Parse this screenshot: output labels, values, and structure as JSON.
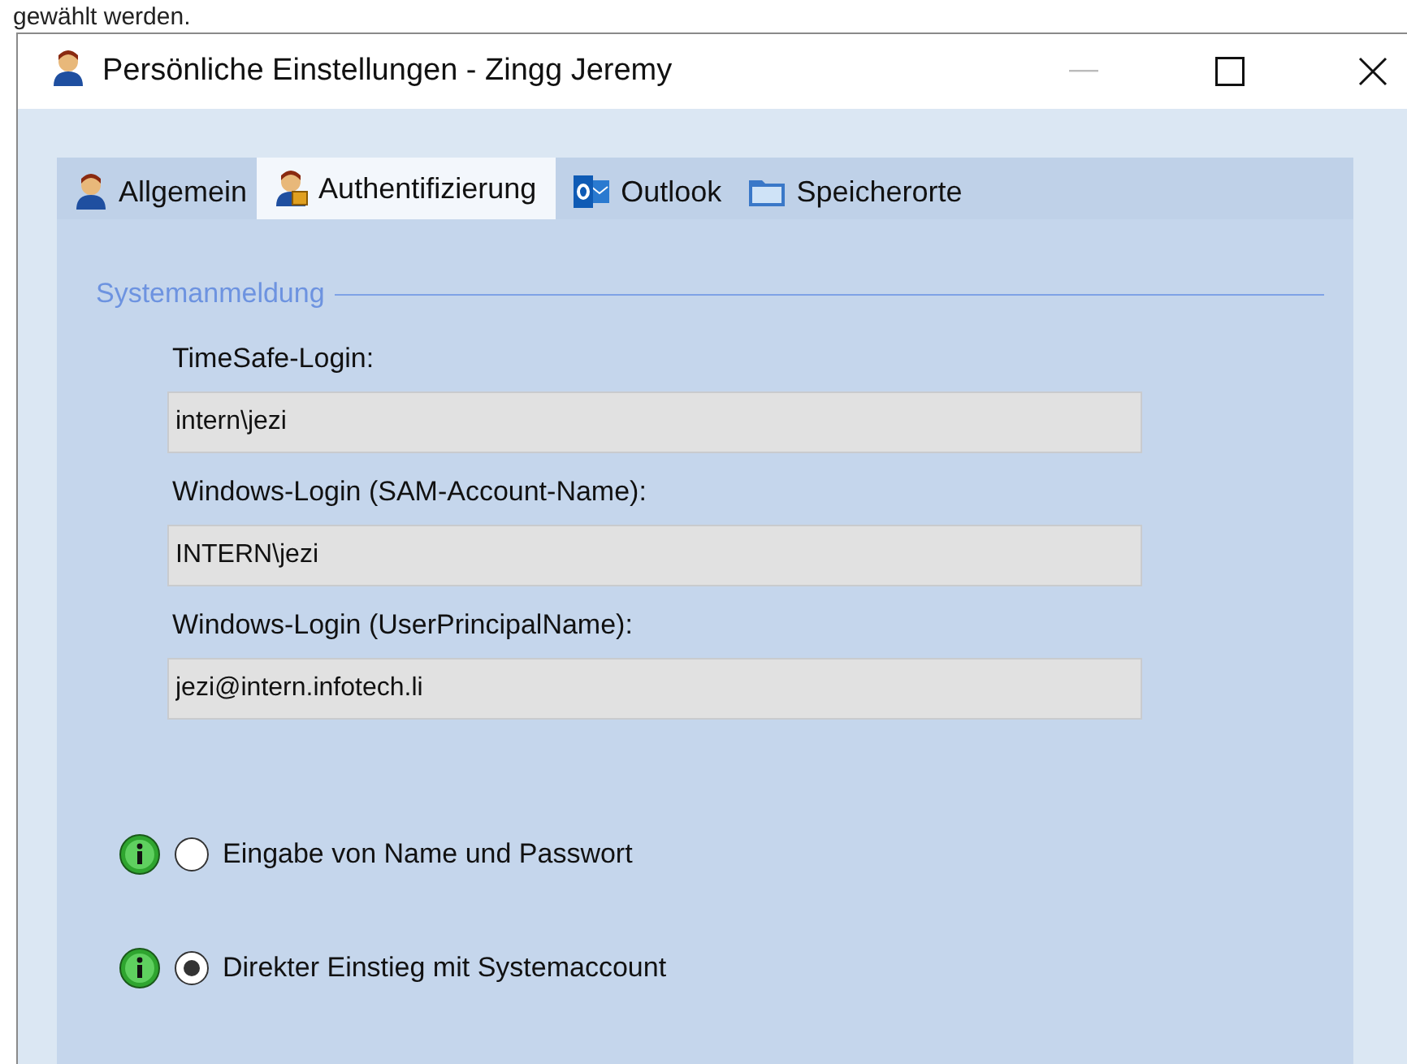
{
  "page_text": "gewählt werden.",
  "window": {
    "title": "Persönliche Einstellungen - Zingg Jeremy"
  },
  "tabs": [
    {
      "label": "Allgemein",
      "kind": "person",
      "selected": false
    },
    {
      "label": "Authentifizierung",
      "kind": "person-key",
      "selected": true
    },
    {
      "label": "Outlook",
      "kind": "outlook",
      "selected": false
    },
    {
      "label": "Speicherorte",
      "kind": "folder",
      "selected": false
    }
  ],
  "group": {
    "title": "Systemanmeldung",
    "fields": [
      {
        "label": "TimeSafe-Login:",
        "value": "intern\\jezi"
      },
      {
        "label": "Windows-Login (SAM-Account-Name):",
        "value": "INTERN\\jezi"
      },
      {
        "label": "Windows-Login (UserPrincipalName):",
        "value": "jezi@intern.infotech.li"
      }
    ]
  },
  "login_options": [
    {
      "label": "Eingabe von Name und Passwort",
      "selected": false
    },
    {
      "label": "Direkter Einstieg mit Systemaccount",
      "selected": true
    }
  ]
}
